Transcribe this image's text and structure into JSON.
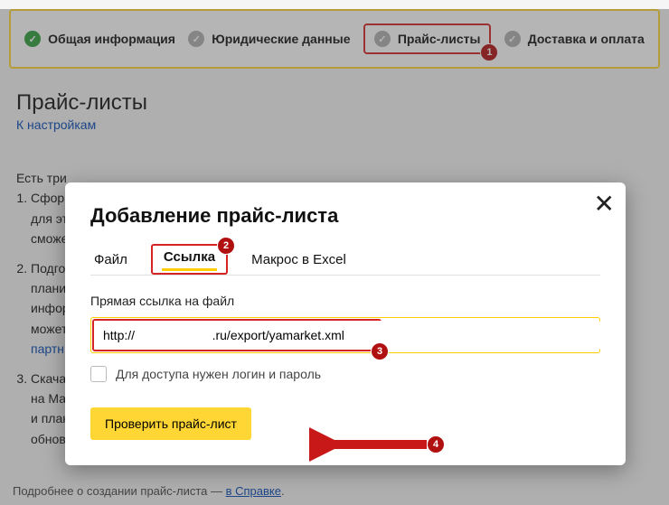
{
  "steps": {
    "general": "Общая информация",
    "legal": "Юридические данные",
    "pricelists": "Прайс-листы",
    "delivery": "Доставка и оплата"
  },
  "page": {
    "title": "Прайс-листы",
    "to_settings": "К настройкам"
  },
  "bg": {
    "intro": "Есть три",
    "li1a": "Сформ",
    "li1b": "для этс",
    "li1c": "сможе",
    "li2a": "Подго",
    "li2b": "плани",
    "li2c": "инфор",
    "li2d": "может",
    "li2e": "партн",
    "li3a": "Скача",
    "li3b": "на Мар",
    "li3c": "и план",
    "li3d": "обнов"
  },
  "footer": {
    "text": "Подробнее о создании прайс-листа — ",
    "link": "в Справке"
  },
  "modal": {
    "title": "Добавление прайс-листа",
    "tabs": {
      "file": "Файл",
      "link": "Ссылка",
      "excel": "Макрос в Excel"
    },
    "field_label": "Прямая ссылка на файл",
    "url_value": "http://                      .ru/export/yamarket.xml",
    "checkbox_label": "Для доступа нужен логин и пароль",
    "check_button": "Проверить прайс-лист"
  },
  "callouts": {
    "c1": "1",
    "c2": "2",
    "c3": "3",
    "c4": "4"
  }
}
